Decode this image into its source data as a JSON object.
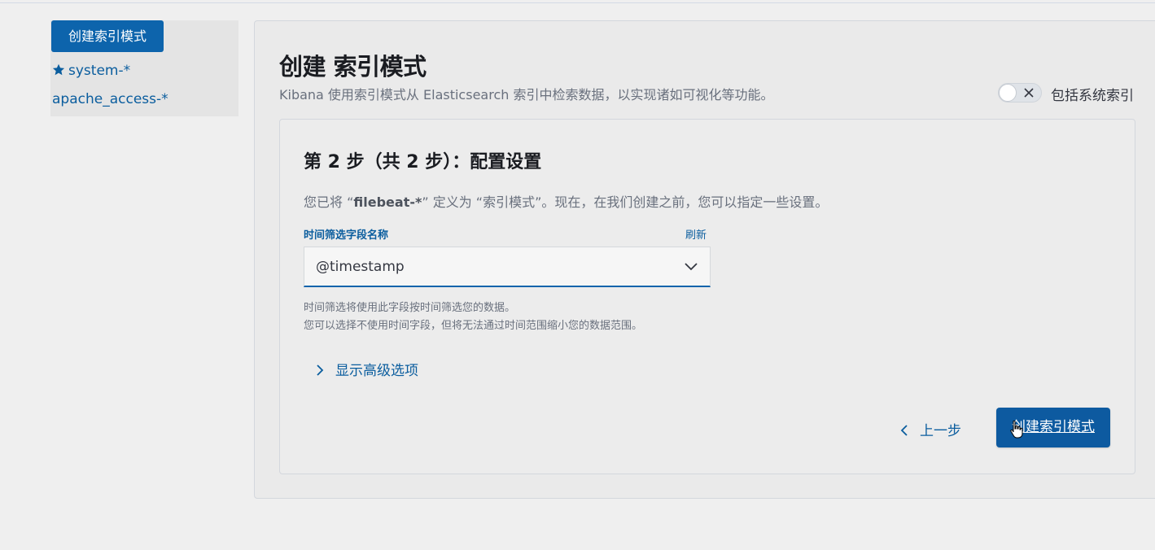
{
  "sidebar": {
    "create_button": "创建索引模式",
    "items": [
      {
        "label": "system-*",
        "starred": true
      },
      {
        "label": "apache_access-*",
        "starred": false
      }
    ]
  },
  "main": {
    "title": "创建 索引模式",
    "subtitle": "Kibana 使用索引模式从 Elasticsearch 索引中检索数据，以实现诸如可视化等功能。",
    "include_system_toggle": {
      "label": "包括系统索引",
      "checked": false
    },
    "step": {
      "title": "第 2 步（共 2 步）：配置设置",
      "desc_prefix": "您已将 “",
      "desc_pattern": "filebeat-*",
      "desc_suffix": "” 定义为 “索引模式”。现在，在我们创建之前，您可以指定一些设置。",
      "field_label": "时间筛选字段名称",
      "refresh_label": "刷新",
      "select_value": "@timestamp",
      "help_line1": "时间筛选将使用此字段按时间筛选您的数据。",
      "help_line2": "您可以选择不使用时间字段，但将无法通过时间范围缩小您的数据范围。",
      "advanced_label": "显示高级选项",
      "back_label": "上一步",
      "create_label": "创建索引模式"
    }
  },
  "colors": {
    "primary": "#0d64ac",
    "link": "#0a5d9e",
    "background": "#efefef"
  },
  "icons": [
    "star-icon",
    "close-icon",
    "chevron-down-icon",
    "chevron-right-icon",
    "chevron-left-icon",
    "pointer-cursor-icon"
  ]
}
